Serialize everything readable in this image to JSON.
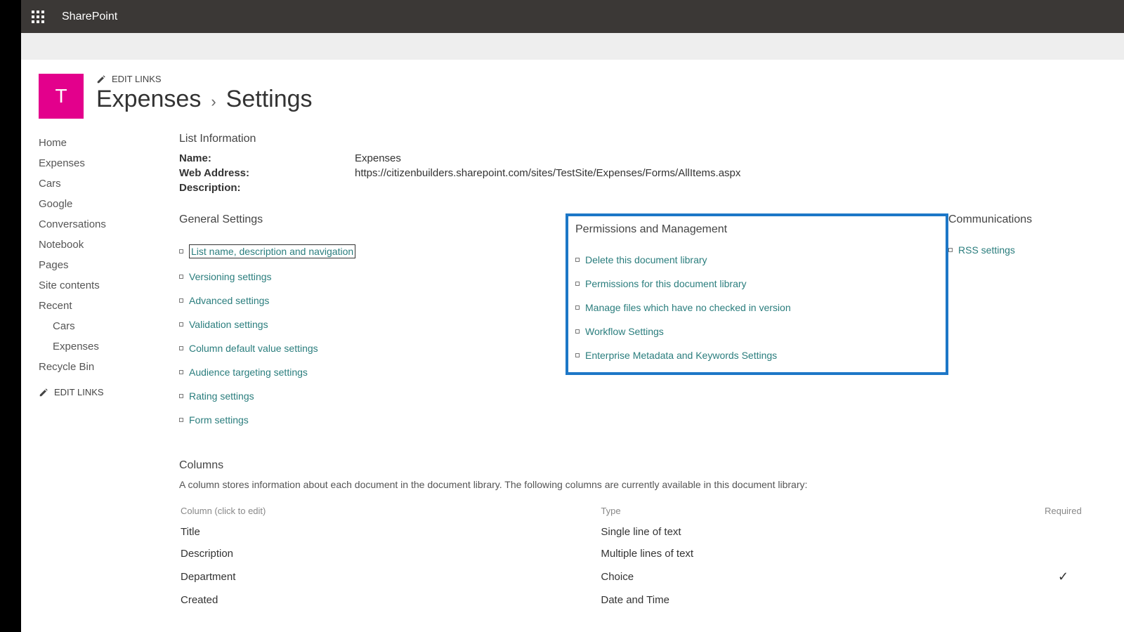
{
  "suite": {
    "app_name": "SharePoint"
  },
  "site": {
    "logo_letter": "T"
  },
  "edit_links_label": "EDIT LINKS",
  "breadcrumb": {
    "main": "Expenses",
    "sub": "Settings"
  },
  "left_nav": {
    "items": [
      {
        "label": "Home"
      },
      {
        "label": "Expenses"
      },
      {
        "label": "Cars"
      },
      {
        "label": "Google"
      },
      {
        "label": "Conversations"
      },
      {
        "label": "Notebook"
      },
      {
        "label": "Pages"
      },
      {
        "label": "Site contents"
      },
      {
        "label": "Recent"
      },
      {
        "label": "Cars",
        "indent": true
      },
      {
        "label": "Expenses",
        "indent": true
      },
      {
        "label": "Recycle Bin"
      }
    ]
  },
  "list_info": {
    "heading": "List Information",
    "rows": [
      {
        "label": "Name:",
        "value": "Expenses"
      },
      {
        "label": "Web Address:",
        "value": "https://citizenbuilders.sharepoint.com/sites/TestSite/Expenses/Forms/AllItems.aspx"
      },
      {
        "label": "Description:",
        "value": ""
      }
    ]
  },
  "general": {
    "heading": "General Settings",
    "links": [
      "List name, description and navigation",
      "Versioning settings",
      "Advanced settings",
      "Validation settings",
      "Column default value settings",
      "Audience targeting settings",
      "Rating settings",
      "Form settings"
    ]
  },
  "perms": {
    "heading": "Permissions and Management",
    "links": [
      "Delete this document library",
      "Permissions for this document library",
      "Manage files which have no checked in version",
      "Workflow Settings",
      "Enterprise Metadata and Keywords Settings"
    ]
  },
  "comms": {
    "heading": "Communications",
    "links": [
      "RSS settings"
    ]
  },
  "columns_section": {
    "heading": "Columns",
    "description": "A column stores information about each document in the document library. The following columns are currently available in this document library:",
    "th_column": "Column (click to edit)",
    "th_type": "Type",
    "th_required": "Required",
    "rows": [
      {
        "name": "Title",
        "type": "Single line of text",
        "required": false
      },
      {
        "name": "Description",
        "type": "Multiple lines of text",
        "required": false
      },
      {
        "name": "Department",
        "type": "Choice",
        "required": true
      },
      {
        "name": "Created",
        "type": "Date and Time",
        "required": false
      }
    ]
  }
}
